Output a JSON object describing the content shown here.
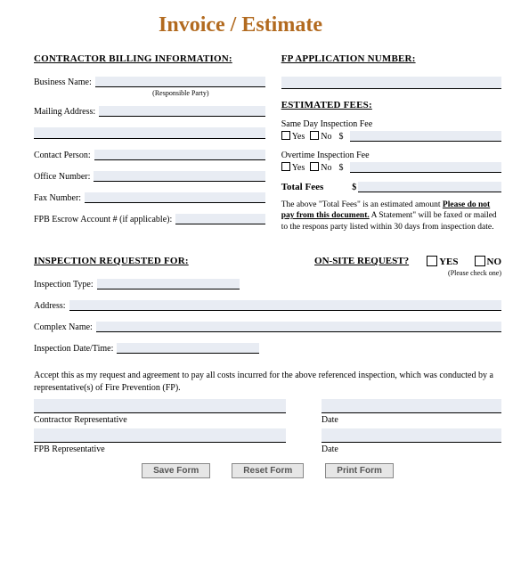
{
  "title": "Invoice / Estimate",
  "left": {
    "heading": "CONTRACTOR BILLING INFORMATION:",
    "business_label": "Business Name:",
    "business_sub": "(Responsible Party)",
    "mailing_label": "Mailing Address:",
    "contact_label": "Contact Person:",
    "office_label": "Office Number:",
    "fax_label": "Fax Number:",
    "escrow_label": "FPB Escrow Account # (if applicable):"
  },
  "right": {
    "heading": "FP APPLICATION NUMBER:",
    "est_heading": "ESTIMATED FEES:",
    "sameday_label": "Same Day Inspection Fee",
    "overtime_label": "Overtime Inspection Fee",
    "yes": "Yes",
    "no": "No",
    "dollar": "$",
    "total_label": "Total Fees",
    "disclaimer_a": "The above \"Total Fees\" is an estimated amount",
    "disclaimer_b": "Please do not pay from this document.",
    "disclaimer_c": "  A Statement\" will be faxed or mailed to the respons party listed within 30 days from inspection date."
  },
  "insp": {
    "heading": "INSPECTION REQUESTED FOR:",
    "type_label": "Inspection Type:",
    "address_label": "Address:",
    "complex_label": "Complex Name:",
    "datetime_label": "Inspection Date/Time:"
  },
  "onsite": {
    "heading": "ON-SITE REQUEST?",
    "yes": "YES",
    "no": "NO",
    "helper": "(Please check one)"
  },
  "agreement": "Accept this as my request and agreement to pay all costs incurred for the above referenced inspection, which was conducted by a representative(s) of Fire Prevention (FP).",
  "sig": {
    "contractor": "Contractor Representative",
    "fpb": "FPB Representative",
    "date": "Date"
  },
  "buttons": {
    "save": "Save Form",
    "reset": "Reset Form",
    "print": "Print Form"
  }
}
